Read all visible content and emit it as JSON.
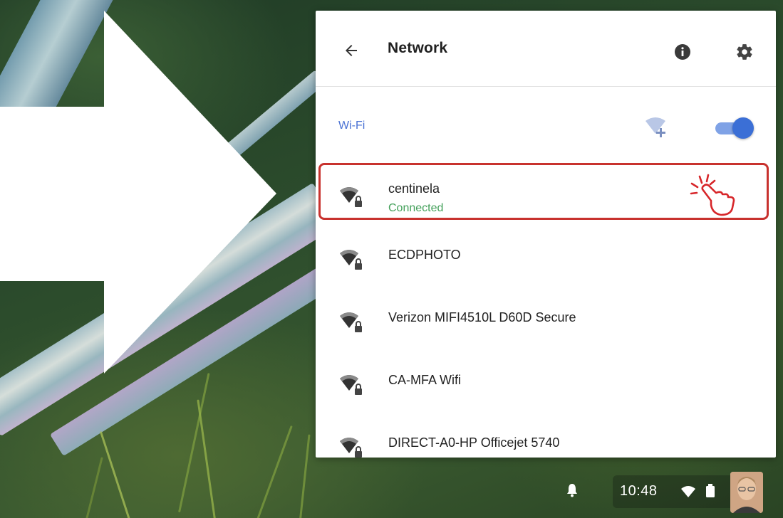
{
  "panel": {
    "title": "Network",
    "back_icon": "arrow-left-icon",
    "info_icon": "info-icon",
    "settings_icon": "gear-icon"
  },
  "wifi": {
    "label": "Wi-Fi",
    "add_network_icon": "add-wifi-icon",
    "enabled": true,
    "accent_color": "#3b6fd6"
  },
  "networks": [
    {
      "name": "centinela",
      "status": "Connected",
      "icon": "wifi-lock-icon",
      "highlighted": true
    },
    {
      "name": "ECDPHOTO",
      "status": "",
      "icon": "wifi-lock-icon"
    },
    {
      "name": "Verizon MIFI4510L D60D Secure",
      "status": "",
      "icon": "wifi-lock-icon"
    },
    {
      "name": "CA-MFA Wifi",
      "status": "",
      "icon": "wifi-lock-icon"
    },
    {
      "name": "DIRECT-A0-HP Officejet 5740",
      "status": "",
      "icon": "wifi-lock-icon"
    }
  ],
  "highlight_color": "#c8322e",
  "connected_color": "#43a05a",
  "shelf": {
    "time": "10:48",
    "notification_icon": "bell-icon",
    "wifi_icon": "wifi-icon",
    "battery_icon": "battery-icon",
    "avatar": "user-avatar"
  }
}
